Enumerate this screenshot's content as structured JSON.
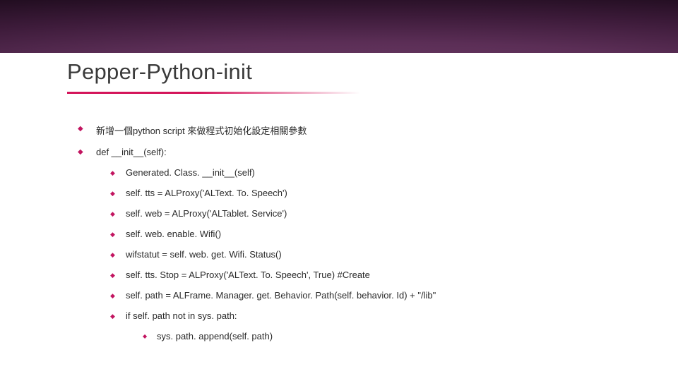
{
  "title": "Pepper-Python-init",
  "bullets_l1": [
    "新增一個python script 來做程式初始化設定相關參數",
    "def __init__(self):"
  ],
  "bullets_l2": [
    "Generated. Class. __init__(self)",
    "self. tts = ALProxy('ALText. To. Speech')",
    "self. web = ALProxy('ALTablet. Service')",
    "self. web. enable. Wifi()",
    "wifstatut = self. web. get. Wifi. Status()",
    "self. tts. Stop = ALProxy('ALText. To. Speech', True) #Create",
    "self. path = ALFrame. Manager. get. Behavior. Path(self. behavior. Id) + \"/lib\"",
    "if self. path not in sys. path:"
  ],
  "bullets_l3": [
    "sys. path. append(self. path)"
  ]
}
